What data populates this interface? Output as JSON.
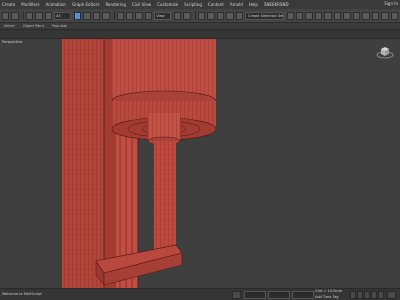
{
  "menubar": {
    "items": [
      "Create",
      "Modifiers",
      "Animation",
      "Graph Editors",
      "Rendering",
      "Civil View",
      "Customize",
      "Scripting",
      "Content",
      "Arnold",
      "Help",
      "SNEEKRSND"
    ],
    "signin": "Sign In"
  },
  "toolbar": {
    "selection_set_placeholder": "Create Selection Set",
    "view_dropdown": "View"
  },
  "ribbon": {
    "tabs": [
      "Select",
      "Object Paint",
      "Populate"
    ]
  },
  "viewport": {
    "label": "Perspective",
    "model_color": "#b3453b"
  },
  "statusbar": {
    "left_text": "Welcome to MAXScript",
    "grid_text": "Grid = 10.0mm",
    "tag_text": "Add Time Tag"
  }
}
